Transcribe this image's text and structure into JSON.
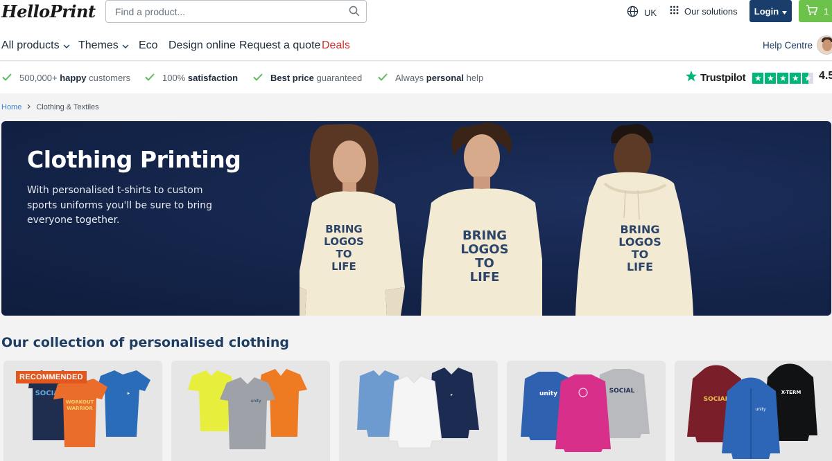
{
  "header": {
    "logo": "HelloPrint",
    "search": {
      "placeholder": "Find a product..."
    },
    "language": "UK",
    "solutions": "Our solutions",
    "login": "Login",
    "cart_count": "1"
  },
  "nav": {
    "items": [
      {
        "label": "All products"
      },
      {
        "label": "Themes"
      },
      {
        "label": "Eco"
      },
      {
        "label": "Design online"
      },
      {
        "label": "Request a quote"
      },
      {
        "label": "Deals"
      }
    ],
    "help": "Help Centre"
  },
  "usp": [
    {
      "pre": "500,000+ ",
      "bold": "happy",
      "post": " customers"
    },
    {
      "pre": "100% ",
      "bold": "satisfaction",
      "post": ""
    },
    {
      "pre": "",
      "bold": "Best price",
      "post": " guaranteed"
    },
    {
      "pre": "Always ",
      "bold": "personal",
      "post": " help"
    }
  ],
  "trustpilot": {
    "name": "Trustpilot",
    "score": "4.5",
    "rating": 4.5
  },
  "breadcrumb": {
    "home": "Home",
    "current": "Clothing & Textiles"
  },
  "hero": {
    "title": "Clothing Printing",
    "subtitle": "With personalised t-shirts to custom sports uniforms you'll be sure to bring everyone together.",
    "garment_print": [
      "BRING",
      "LOGOS",
      "TO",
      "LIFE"
    ]
  },
  "collection": {
    "title": "Our collection of personalised clothing",
    "badge": "RECOMMENDED",
    "garment_texts": [
      "SOCIAL",
      "WORKOUT",
      "WARRIOR",
      "unity",
      "SOCIAL",
      "unity",
      "SOCIAL",
      "unity",
      "X-TERM"
    ]
  },
  "colors": {
    "brand_navy": "#193e6b",
    "cart_green": "#6cc24a",
    "deals_red": "#d2322d",
    "badge_orange": "#e2571e",
    "trust_green": "#00b67a",
    "hero_bg": "#14244a"
  }
}
